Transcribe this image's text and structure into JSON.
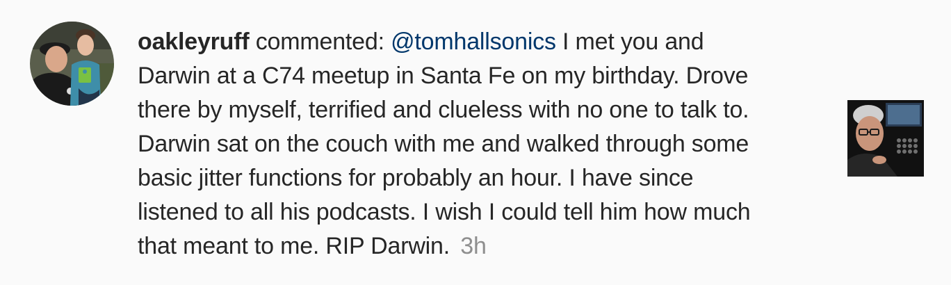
{
  "comment": {
    "username": "oakleyruff",
    "action": "commented:",
    "mention": "@tomhallsonics",
    "lines": [
      "I met you and",
      "Darwin at a C74 meetup in Santa Fe on my birthday. Drove",
      "there by myself, terrified and clueless with no one to talk to.",
      "Darwin sat on the couch with me and walked through some",
      "basic jitter functions for probably an hour. I have since",
      "listened to all his podcasts. I wish I could tell him how much",
      "that meant to me. RIP Darwin."
    ],
    "timestamp": "3h"
  },
  "colors": {
    "background": "#fafafa",
    "text": "#262626",
    "mention": "#00376b",
    "timestamp": "#8e8e8e"
  }
}
